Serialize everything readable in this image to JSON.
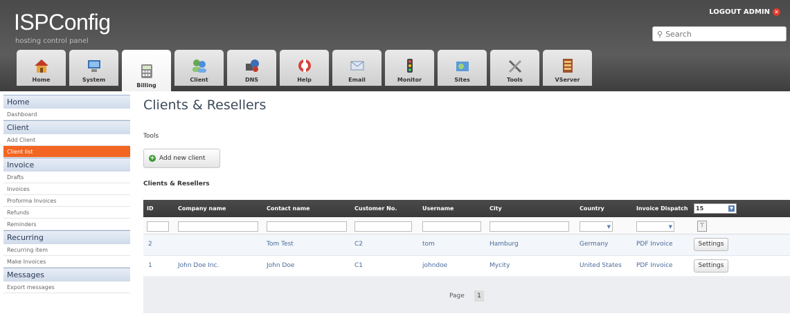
{
  "header": {
    "logo": "ISPConfig",
    "tagline": "hosting control panel",
    "logout_label": "LOGOUT ADMIN",
    "search_placeholder": "Search"
  },
  "tabs": [
    {
      "label": "Home",
      "icon": "home-icon"
    },
    {
      "label": "System",
      "icon": "system-icon"
    },
    {
      "label": "Billing",
      "icon": "billing-icon",
      "active": true
    },
    {
      "label": "Client",
      "icon": "client-icon"
    },
    {
      "label": "DNS",
      "icon": "dns-icon"
    },
    {
      "label": "Help",
      "icon": "help-icon"
    },
    {
      "label": "Email",
      "icon": "email-icon"
    },
    {
      "label": "Monitor",
      "icon": "monitor-icon"
    },
    {
      "label": "Sites",
      "icon": "sites-icon"
    },
    {
      "label": "Tools",
      "icon": "tools-icon"
    },
    {
      "label": "VServer",
      "icon": "vserver-icon"
    }
  ],
  "sidebar": {
    "home_head": "Home",
    "dashboard": "Dashboard",
    "client_head": "Client",
    "add_client": "Add Client",
    "client_list": "Client list",
    "invoice_head": "Invoice",
    "drafts": "Drafts",
    "invoices": "Invoices",
    "proforma": "Proforma Invoices",
    "refunds": "Refunds",
    "reminders": "Reminders",
    "recurring_head": "Recurring",
    "recurring_item": "Recurring item",
    "make_invoices": "Make Invoices",
    "messages_head": "Messages",
    "export_messages": "Export messages"
  },
  "main": {
    "title": "Clients & Resellers",
    "tools_label": "Tools",
    "add_button": "Add new client",
    "list_label": "Clients & Resellers"
  },
  "table": {
    "columns": [
      "ID",
      "Company name",
      "Contact name",
      "Customer No.",
      "Username",
      "City",
      "Country",
      "Invoice Dispatch"
    ],
    "per_page": "15",
    "rows": [
      {
        "id": "2",
        "company": "",
        "contact": "Tom Test",
        "customer_no": "C2",
        "username": "tom",
        "city": "Hamburg",
        "country": "Germany",
        "dispatch": "PDF Invoice",
        "action": "Settings"
      },
      {
        "id": "1",
        "company": "John Doe Inc.",
        "contact": "John Doe",
        "customer_no": "C1",
        "username": "johndoe",
        "city": "Mycity",
        "country": "United States",
        "dispatch": "PDF Invoice",
        "action": "Settings"
      }
    ],
    "page_label": "Page",
    "page_number": "1"
  },
  "colors": {
    "accent": "#f26522",
    "header": "#4a4a4a"
  }
}
